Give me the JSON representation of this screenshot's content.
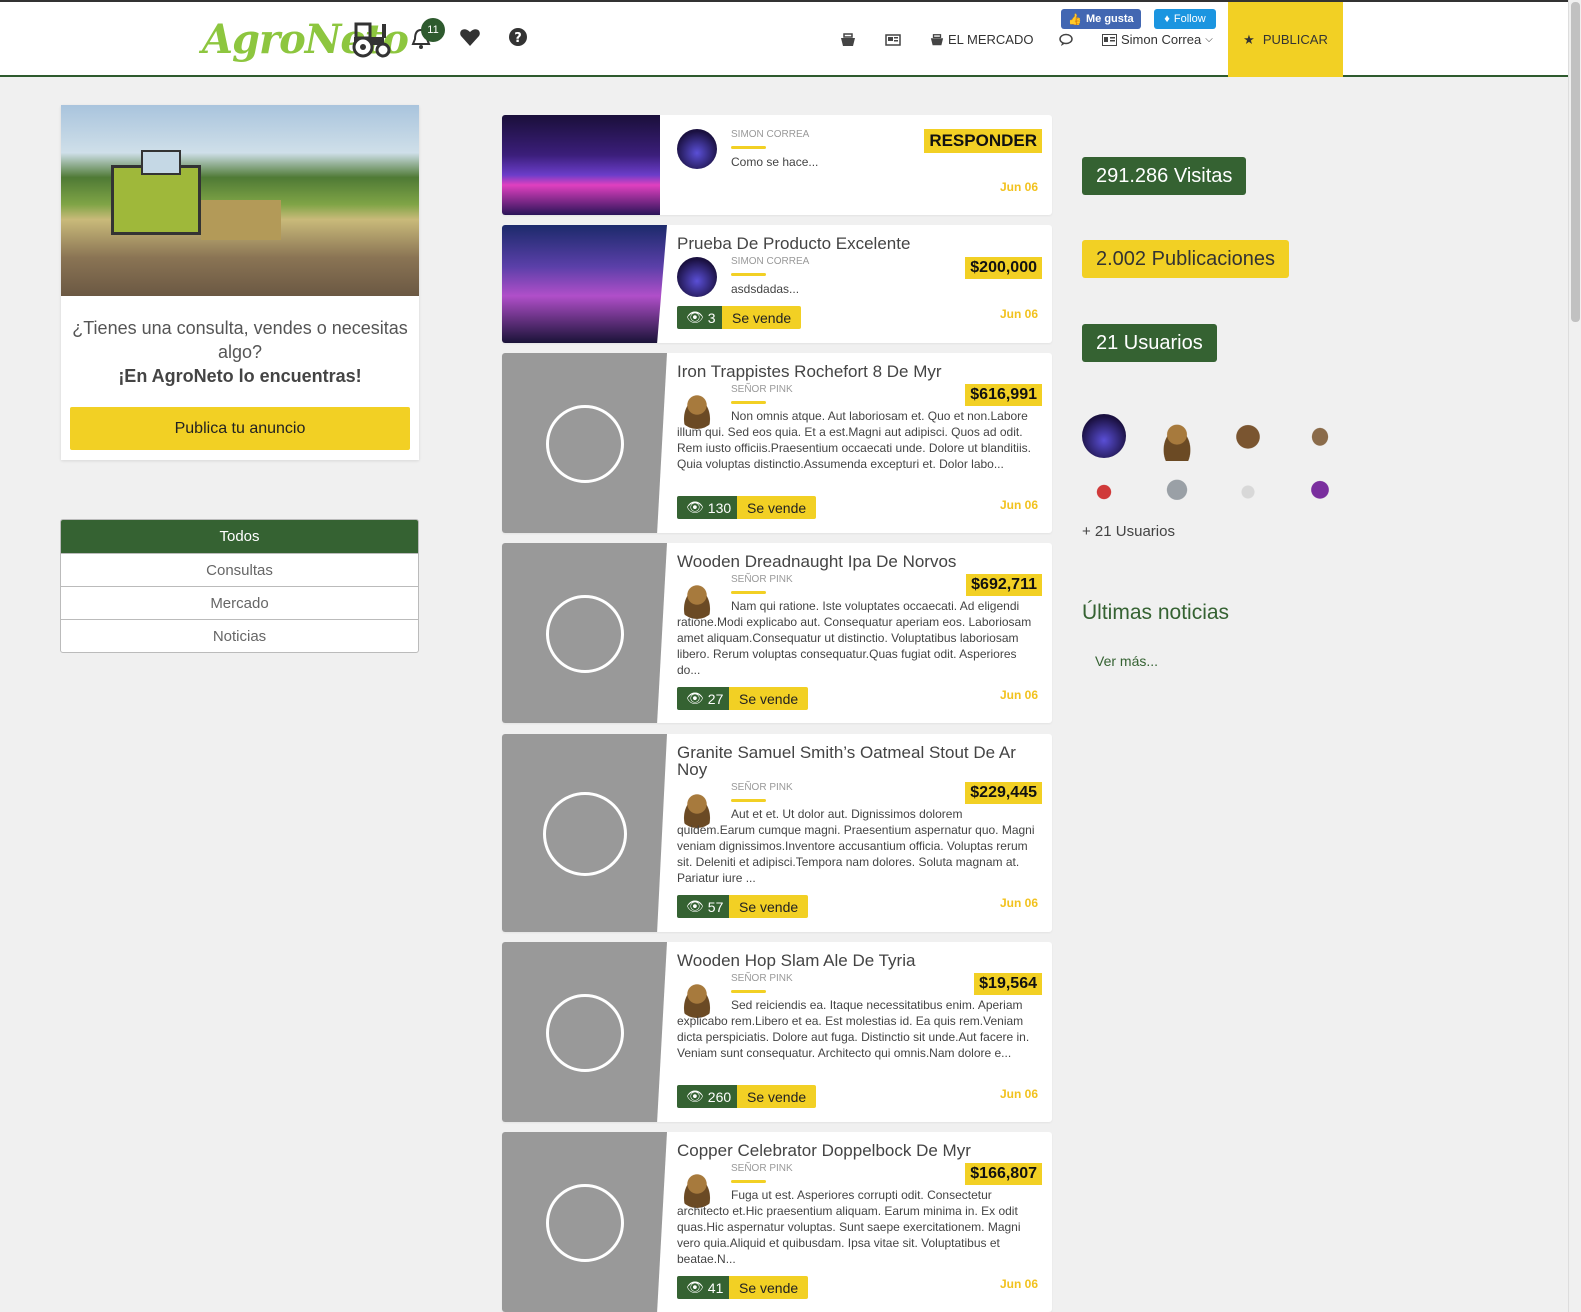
{
  "header": {
    "logo": "AgroNeto",
    "notifications_count": "11",
    "nav": {
      "mercado": "EL MERCADO",
      "user": "Simon Correa",
      "publicar": "PUBLICAR"
    },
    "social": {
      "facebook": "Me gusta",
      "twitter": "Follow"
    }
  },
  "sidebar": {
    "promo_question": "¿Tienes una consulta, vendes o necesitas algo?",
    "promo_tagline": "¡En AgroNeto lo encuentras!",
    "promo_button": "Publica tu anuncio",
    "filters": [
      "Todos",
      "Consultas",
      "Mercado",
      "Noticias"
    ]
  },
  "feed": {
    "respond_label": "RESPONDER",
    "sale_label": "Se vende",
    "posts": [
      {
        "title": "",
        "author": "SIMON CORREA",
        "text": "Como se hace...",
        "date": "Jun 06"
      },
      {
        "title": "Prueba De Producto Excelente",
        "author": "SIMON CORREA",
        "price": "$200,000",
        "text": "asdsdadas...",
        "views": "3",
        "date": "Jun 06"
      },
      {
        "title": "Iron Trappistes Rochefort 8 De Myr",
        "author": "SEÑOR PINK",
        "price": "$616,991",
        "text": "Non omnis atque. Aut laboriosam et. Quo et non.Labore illum qui. Sed eos quia. Et a est.Magni aut adipisci. Quos ad odit. Rem iusto officiis.Praesentium occaecati unde. Dolore ut blanditiis. Quia voluptas distinctio.Assumenda excepturi et. Dolor labo...",
        "views": "130",
        "date": "Jun 06"
      },
      {
        "title": "Wooden Dreadnaught Ipa De Norvos",
        "author": "SEÑOR PINK",
        "price": "$692,711",
        "text": "Nam qui ratione. Iste voluptates occaecati. Ad eligendi ratione.Modi explicabo aut. Consequatur aperiam eos. Laboriosam amet aliquam.Consequatur ut distinctio. Voluptatibus laboriosam libero. Rerum voluptas consequatur.Quas fugiat odit. Asperiores do...",
        "views": "27",
        "date": "Jun 06"
      },
      {
        "title": "Granite Samuel Smith’s Oatmeal Stout De Ar Noy",
        "author": "SEÑOR PINK",
        "price": "$229,445",
        "text": "Aut et et. Ut dolor aut. Dignissimos dolorem quidem.Earum cumque magni. Praesentium aspernatur quo. Magni veniam dignissimos.Inventore accusantium officia. Voluptas rerum sit. Deleniti et adipisci.Tempora nam dolores. Soluta magnam at. Pariatur iure ...",
        "views": "57",
        "date": "Jun 06"
      },
      {
        "title": "Wooden Hop Slam Ale De Tyria",
        "author": "SEÑOR PINK",
        "price": "$19,564",
        "text": "Sed reiciendis ea. Itaque necessitatibus enim. Aperiam explicabo rem.Libero et ea. Est molestias id. Ea quis rem.Veniam dicta perspiciatis. Dolore aut fuga. Distinctio sit unde.Aut facere in. Veniam sunt consequatur. Architecto qui omnis.Nam dolore e...",
        "views": "260",
        "date": "Jun 06"
      },
      {
        "title": "Copper Celebrator Doppelbock De Myr",
        "author": "SEÑOR PINK",
        "price": "$166,807",
        "text": "Fuga ut est. Asperiores corrupti odit. Consectetur architecto et.Hic praesentium aliquam. Earum minima in. Ex odit quas.Hic aspernatur voluptas. Sunt saepe exercitationem. Magni vero quia.Aliquid et quibusdam. Ipsa vitae sit. Voluptatibus et beatae.N...",
        "views": "41",
        "date": "Jun 06"
      }
    ]
  },
  "stats": {
    "visits": "291.286 Visitas",
    "posts": "2.002 Publicaciones",
    "users": "21 Usuarios",
    "more_users": "+ 21 Usuarios"
  },
  "news": {
    "title": "Últimas noticias",
    "see_more": "Ver más..."
  },
  "colors": {
    "green": "#356232",
    "yellow": "#f2d024",
    "logo_green": "#8dc63f"
  }
}
